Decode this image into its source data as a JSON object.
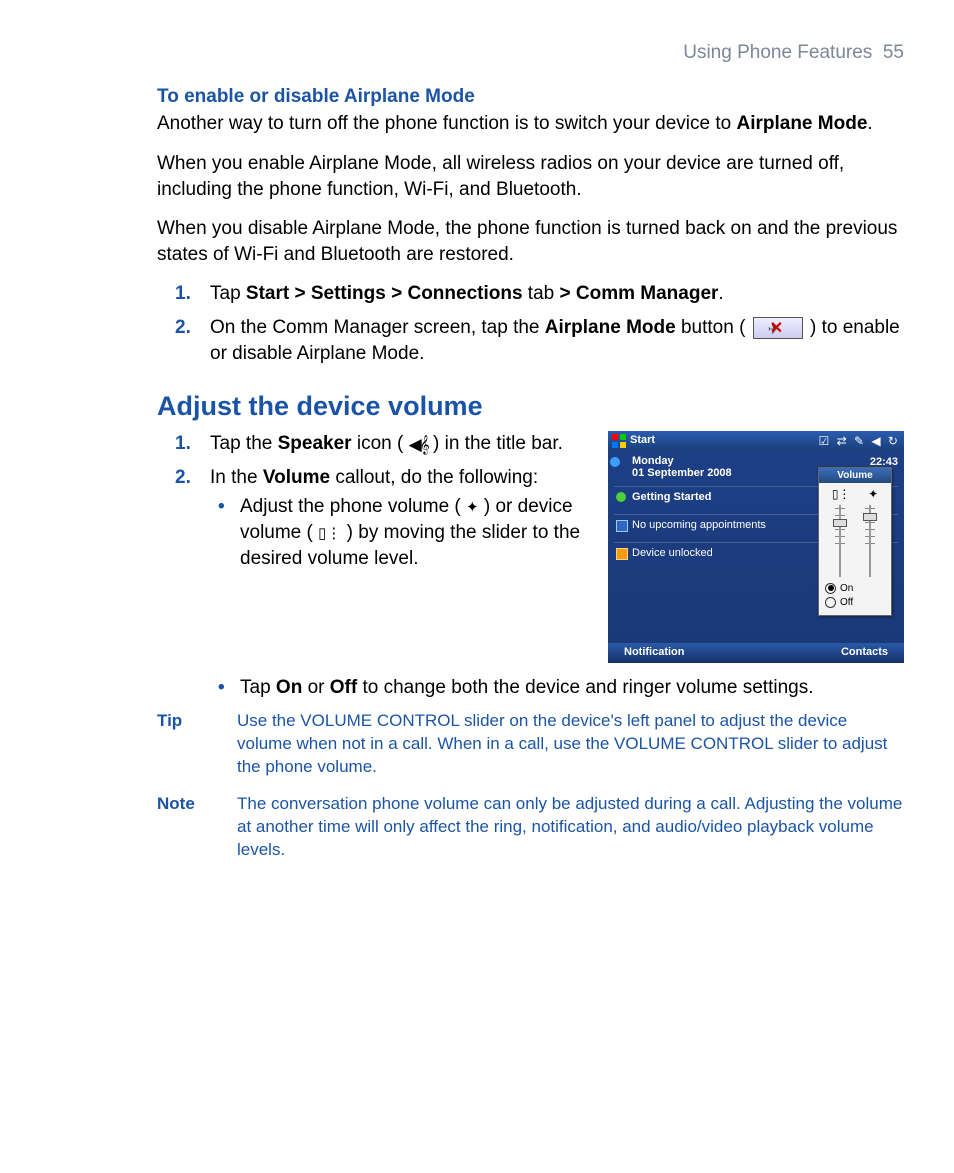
{
  "header": {
    "chapter": "Using Phone Features",
    "page": "55"
  },
  "airplane": {
    "heading": "To enable or disable Airplane Mode",
    "p1a": "Another way to turn off the phone function is to switch your device to ",
    "p1b": "Airplane Mode",
    "p1c": ".",
    "p2": "When you enable Airplane Mode, all wireless radios on your device are turned off, including the phone function, Wi-Fi, and Bluetooth.",
    "p3": "When you disable Airplane Mode, the phone function is turned back on and the previous states of Wi-Fi and Bluetooth are restored.",
    "steps": {
      "s1": {
        "num": "1.",
        "pre": "Tap ",
        "bold": "Start > Settings > Connections",
        "mid": " tab ",
        "bold2": "> Comm Manager",
        "post": "."
      },
      "s2": {
        "num": "2.",
        "pre": "On the Comm Manager screen, tap the ",
        "bold": "Airplane Mode",
        "mid": " button ( ",
        "post": " ) to enable or disable Airplane Mode."
      }
    }
  },
  "volume": {
    "heading": "Adjust the device volume",
    "steps": {
      "s1": {
        "num": "1.",
        "pre": "Tap the ",
        "bold": "Speaker",
        "mid": " icon ( ",
        "post": " ) in the title bar."
      },
      "s2": {
        "num": "2.",
        "pre": "In the ",
        "bold": "Volume",
        "post": " callout, do the following:"
      }
    },
    "bullets": {
      "b1": {
        "pre": "Adjust the phone volume ( ",
        "mid1": " ) or device volume ( ",
        "mid2": " ) by moving the slider to the desired volume level."
      },
      "b2": {
        "pre": "Tap ",
        "on": "On",
        "mid": " or ",
        "off": "Off",
        "post": " to change both the device and ringer volume settings."
      }
    }
  },
  "tip": {
    "label": "Tip",
    "text": "Use the VOLUME CONTROL slider on the device's left panel to adjust the device volume when not in a call. When in a call, use the VOLUME CONTROL slider to adjust the phone volume."
  },
  "note": {
    "label": "Note",
    "text": "The conversation phone volume can only be adjusted during a call. Adjusting the volume at another time will only affect the ring, notification, and audio/video playback volume levels."
  },
  "screenshot": {
    "start": "Start",
    "tray": "☑ ⇄ ✎ ◀ ↻",
    "day": "Monday",
    "date": "01 September 2008",
    "time": "22:43",
    "row1": "Getting Started",
    "row2": "No upcoming appointments",
    "row3": "Device unlocked",
    "soft_left": "Notification",
    "soft_right": "Contacts",
    "popup": {
      "title": "Volume",
      "on": "On",
      "off": "Off"
    }
  }
}
